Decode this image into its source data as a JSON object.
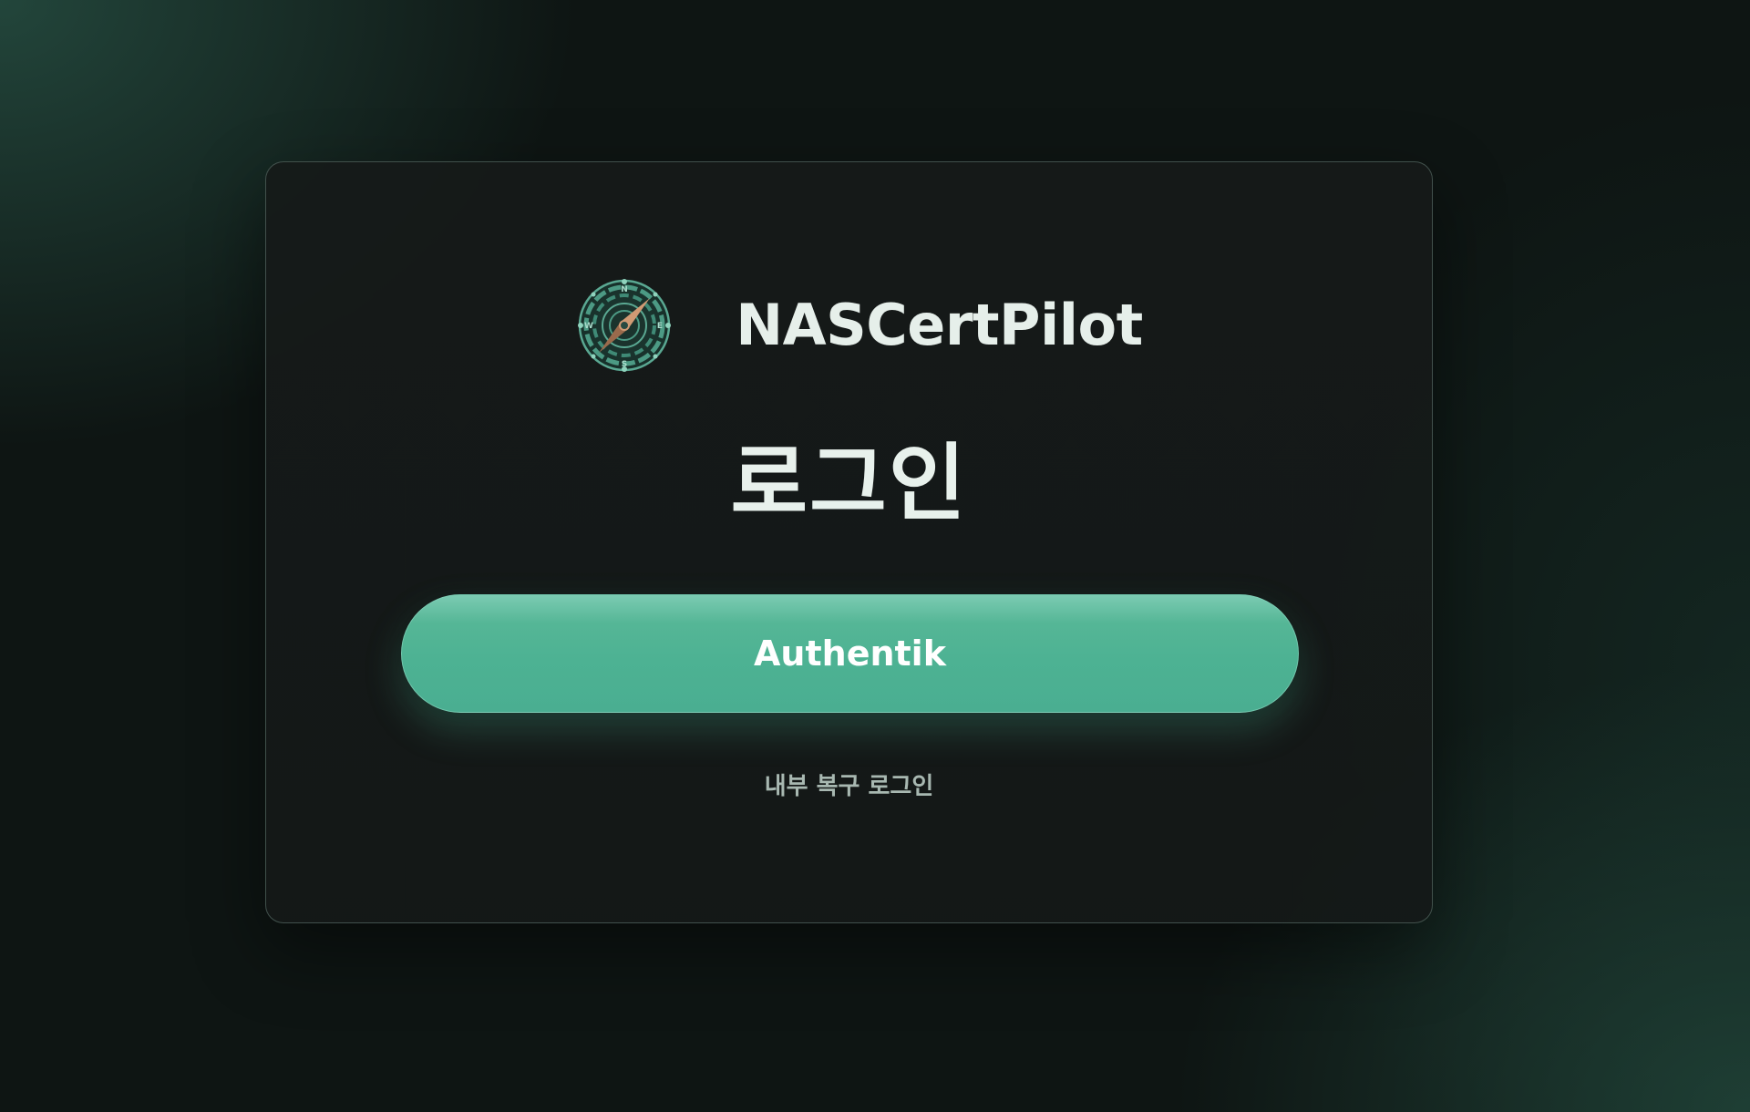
{
  "brand": {
    "name": "NASCertPilot",
    "logo_icon": "compass-icon"
  },
  "login": {
    "title": "로그인",
    "sso_button_label": "Authentik",
    "recovery_link_label": "내부 복구 로그인"
  },
  "colors": {
    "accent": "#4db293",
    "accent_light": "#7bcbb2",
    "background": "#0e1513",
    "card_border": "#5f736c",
    "text_primary": "#e8f1ec",
    "text_muted": "#a8b8b1",
    "logo_needle": "#c4926f",
    "logo_ring": "#5aa892"
  }
}
